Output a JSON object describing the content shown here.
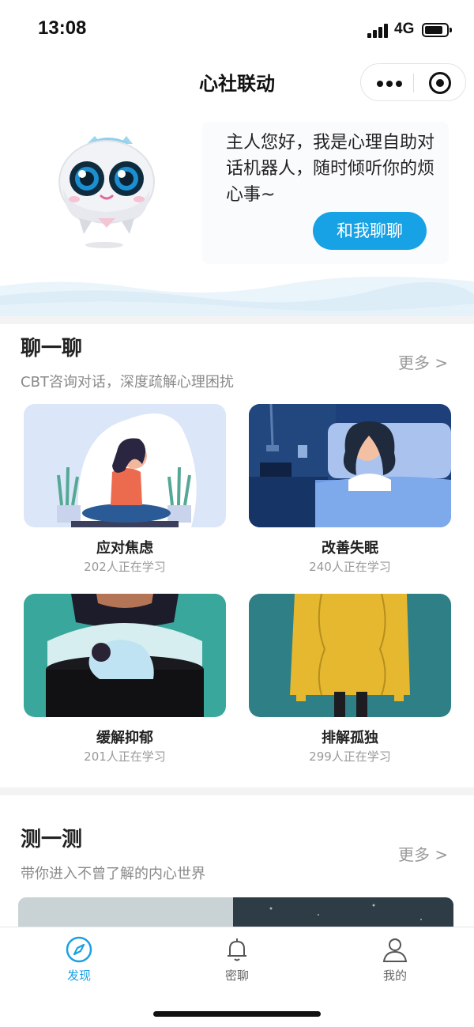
{
  "status_bar": {
    "time": "13:08",
    "network": "4G"
  },
  "nav": {
    "title": "心社联动",
    "more_icon": "more-dots-icon",
    "close_icon": "target-circle-icon"
  },
  "hero": {
    "greeting": "主人您好，我是心理自助对话机器人，随时倾听你的烦心事~",
    "button": "和我聊聊",
    "accent_color": "#17a2e6"
  },
  "chat_section": {
    "title": "聊一聊",
    "subtitle": "CBT咨询对话，深度疏解心理困扰",
    "more": "更多 >",
    "cards": [
      {
        "title": "应对焦虑",
        "count": "202人正在学习"
      },
      {
        "title": "改善失眠",
        "count": "240人正在学习"
      },
      {
        "title": "缓解抑郁",
        "count": "201人正在学习"
      },
      {
        "title": "排解孤独",
        "count": "299人正在学习"
      }
    ]
  },
  "test_section": {
    "title": "测一测",
    "subtitle": "带你进入不曾了解的内心世界",
    "more": "更多 >"
  },
  "tab_bar": {
    "tabs": [
      {
        "label": "发现",
        "icon": "compass-icon",
        "active": true
      },
      {
        "label": "密聊",
        "icon": "bell-icon",
        "active": false
      },
      {
        "label": "我的",
        "icon": "user-icon",
        "active": false
      }
    ],
    "active_color": "#1aa0e3"
  }
}
